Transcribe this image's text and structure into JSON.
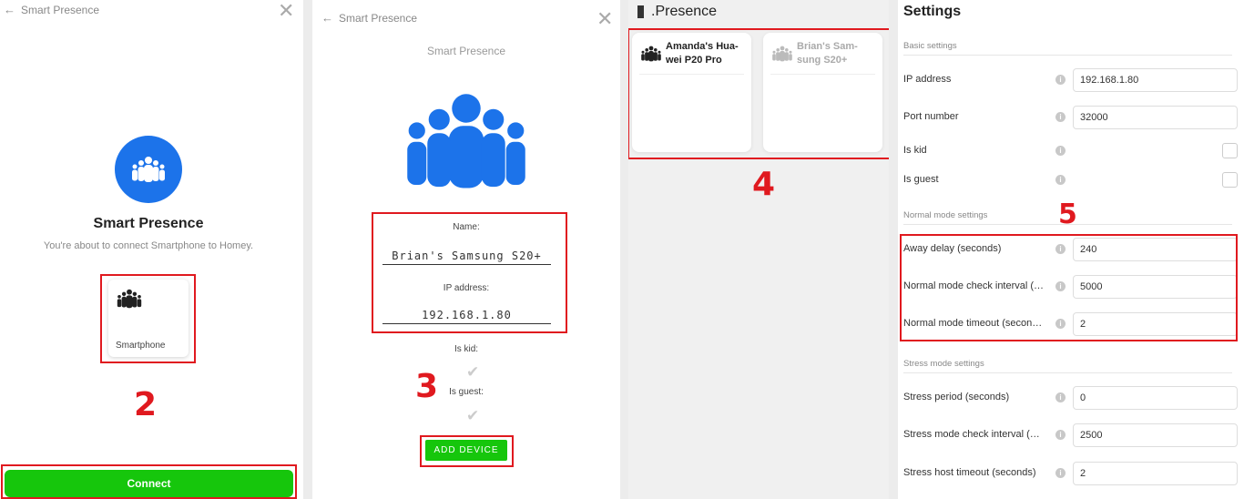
{
  "panel1": {
    "header": "Smart Presence",
    "title": "Smart Presence",
    "subtitle": "You're about to connect Smartphone to Homey.",
    "device_card_label": "Smartphone",
    "connect_label": "Connect",
    "step_number": "2"
  },
  "panel2": {
    "header": "Smart Presence",
    "title": "Smart Presence",
    "name_label": "Name:",
    "name_value": "Brian's Samsung S20+",
    "ip_label": "IP address:",
    "ip_value": "192.168.1.80",
    "is_kid_label": "Is kid:",
    "is_guest_label": "Is guest:",
    "add_device_label": "ADD DEVICE",
    "step_number": "3"
  },
  "panel3": {
    "title": ".Presence",
    "devices": [
      {
        "name": "Amanda's Hua-wei P20 Pro"
      },
      {
        "name": "Brian's Sam-sung S20+"
      }
    ],
    "step_number": "4"
  },
  "panel4": {
    "title": "Settings",
    "basic_section": "Basic settings",
    "normal_section": "Normal mode settings",
    "stress_section": "Stress mode settings",
    "basic_rows": [
      {
        "label": "IP address",
        "value": "192.168.1.80"
      },
      {
        "label": "Port number",
        "value": "32000"
      },
      {
        "label": "Is kid",
        "value": ""
      },
      {
        "label": "Is guest",
        "value": ""
      }
    ],
    "normal_rows": [
      {
        "label": "Away delay (seconds)",
        "value": "240"
      },
      {
        "label": "Normal mode check interval (…",
        "value": "5000"
      },
      {
        "label": "Normal mode timeout (secon…",
        "value": "2"
      }
    ],
    "stress_rows": [
      {
        "label": "Stress period (seconds)",
        "value": "0"
      },
      {
        "label": "Stress mode check interval (…",
        "value": "2500"
      },
      {
        "label": "Stress host timeout (seconds)",
        "value": "2"
      }
    ],
    "step_number": "5"
  },
  "colors": {
    "accent_blue": "#1c73ea",
    "button_green": "#16c60c",
    "highlight_red": "#e0191f"
  }
}
